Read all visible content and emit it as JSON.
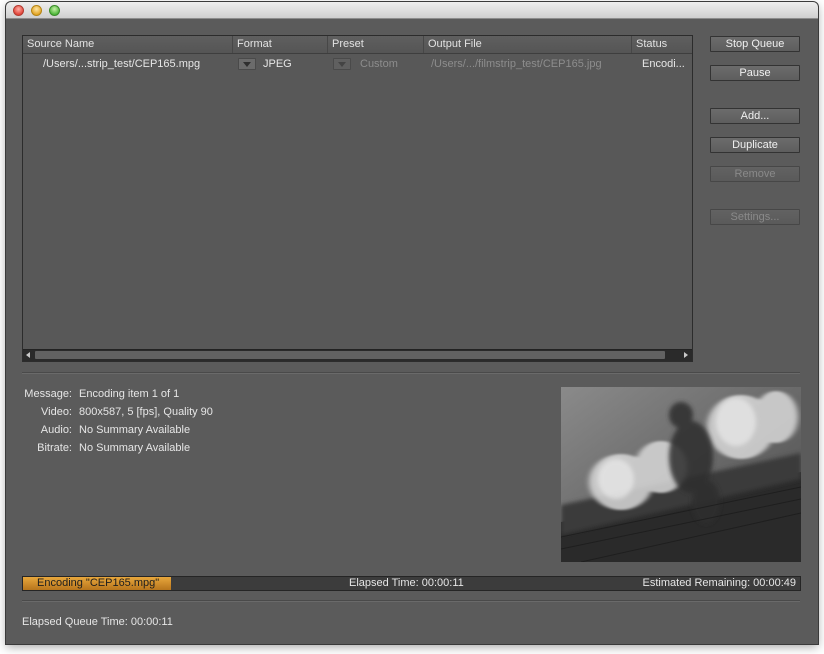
{
  "window": {
    "controls": [
      "close",
      "minimize",
      "zoom"
    ]
  },
  "table": {
    "columns": [
      "Source Name",
      "Format",
      "Preset",
      "Output File",
      "Status"
    ],
    "rows": [
      {
        "source": "/Users/...strip_test/CEP165.mpg",
        "format": "JPEG",
        "preset": "Custom",
        "output": "/Users/.../filmstrip_test/CEP165.jpg",
        "status": "Encodi..."
      }
    ]
  },
  "buttons": {
    "stop_queue": "Stop Queue",
    "pause": "Pause",
    "add": "Add...",
    "duplicate": "Duplicate",
    "remove": "Remove",
    "settings": "Settings..."
  },
  "summary": {
    "message_label": "Message:",
    "message": "Encoding item 1 of 1",
    "video_label": "Video:",
    "video": "800x587, 5 [fps], Quality 90",
    "audio_label": "Audio:",
    "audio": "No Summary Available",
    "bitrate_label": "Bitrate:",
    "bitrate": "No Summary Available"
  },
  "progress": {
    "fraction": 0.19,
    "label": "Encoding \"CEP165.mpg\"",
    "elapsed": "Elapsed Time: 00:00:11",
    "remaining": "Estimated Remaining: 00:00:49"
  },
  "queue_time": "Elapsed Queue Time:  00:00:11",
  "colors": {
    "progress_fill": "#d39031",
    "window_bg": "#5b5b5b"
  }
}
